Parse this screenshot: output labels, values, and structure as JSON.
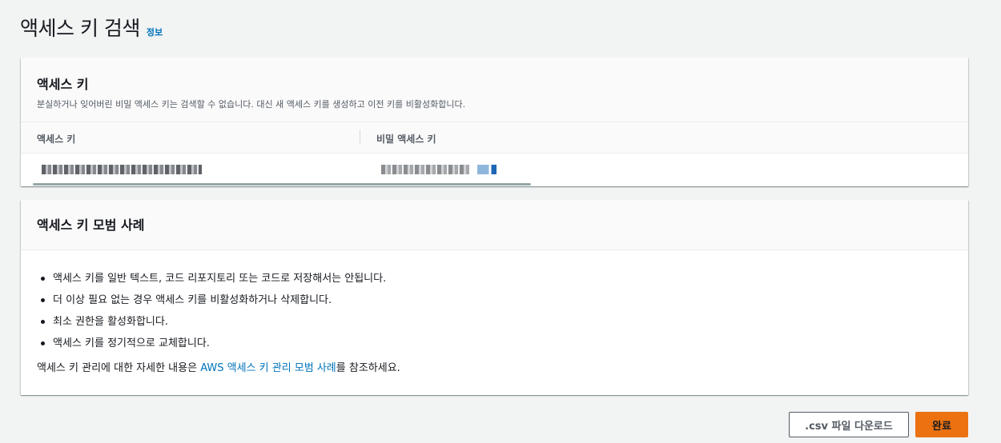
{
  "header": {
    "title": "액세스 키 검색",
    "info_link": "정보"
  },
  "access_keys_panel": {
    "title": "액세스 키",
    "description": "분실하거나 잊어버린 비밀 액세스 키는 검색할 수 없습니다. 대신 새 액세스 키를 생성하고 이전 키를 비활성화합니다.",
    "columns": [
      "액세스 키",
      "비밀 액세스 키"
    ]
  },
  "best_practices_panel": {
    "title": "액세스 키 모범 사례",
    "items": [
      "액세스 키를 일반 텍스트, 코드 리포지토리 또는 코드로 저장해서는 안됩니다.",
      "더 이상 필요 없는 경우 액세스 키를 비활성화하거나 삭제합니다.",
      "최소 권한을 활성화합니다.",
      "액세스 키를 정기적으로 교체합니다."
    ],
    "more_prefix": "액세스 키 관리에 대한 자세한 내용은 ",
    "more_link": "AWS 액세스 키 관리 모범 사례",
    "more_suffix": "를 참조하세요."
  },
  "buttons": {
    "download_csv": ".csv 파일 다운로드",
    "done": "완료"
  },
  "colors": {
    "accent": "#ec7211",
    "link": "#0073bb",
    "background": "#f2f3f3"
  }
}
